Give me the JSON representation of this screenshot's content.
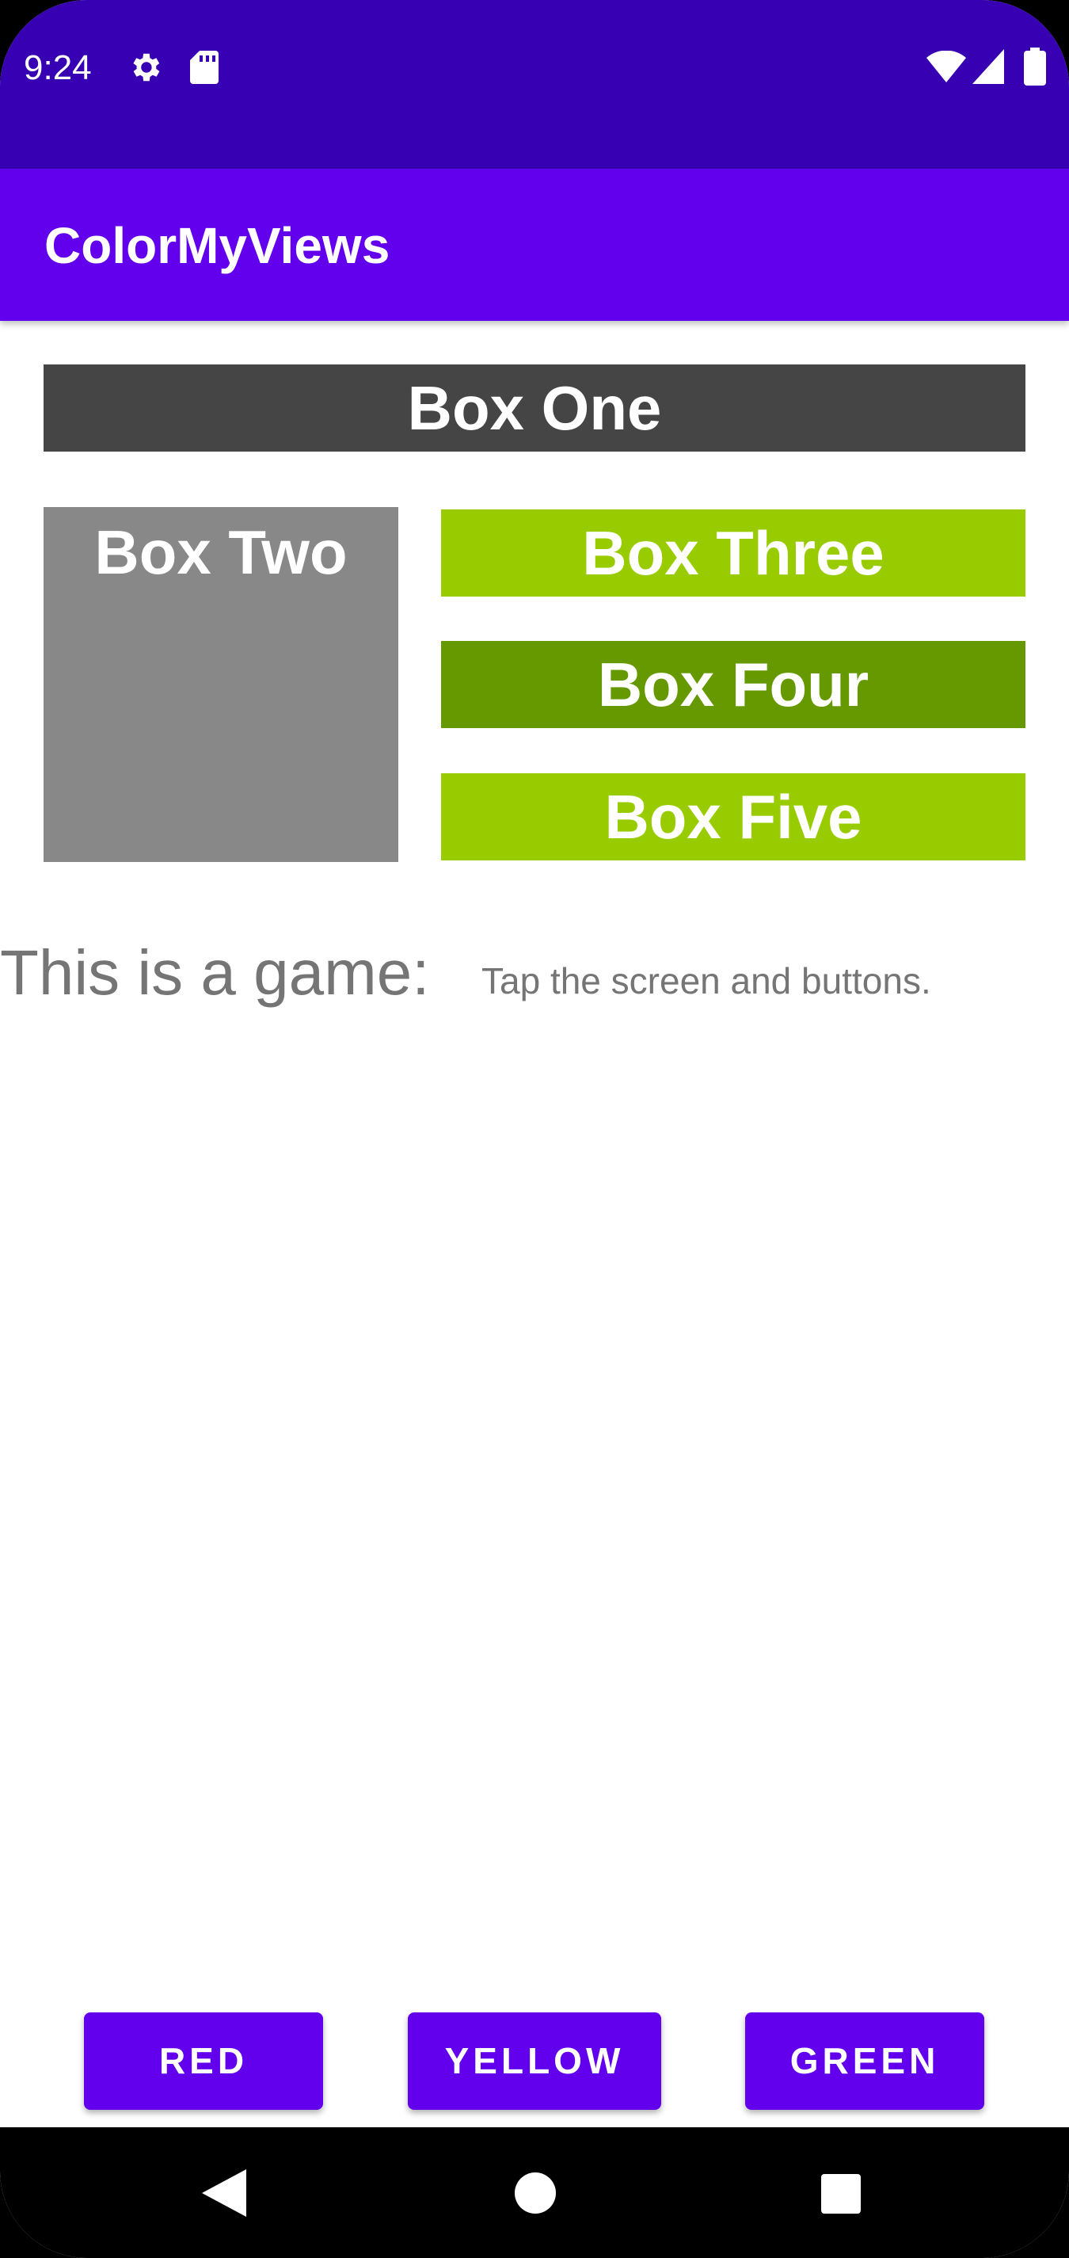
{
  "status_bar": {
    "time": "9:24",
    "icons": [
      "gear-icon",
      "sd-card-icon",
      "wifi-icon",
      "signal-icon",
      "battery-icon"
    ],
    "background": "#3700B3"
  },
  "app_bar": {
    "title": "ColorMyViews",
    "background": "#6200EE"
  },
  "boxes": {
    "one": {
      "label": "Box One",
      "color": "#454545"
    },
    "two": {
      "label": "Box Two",
      "color": "#888888"
    },
    "three": {
      "label": "Box Three",
      "color": "#99CC00"
    },
    "four": {
      "label": "Box Four",
      "color": "#669900"
    },
    "five": {
      "label": "Box Five",
      "color": "#99CC00"
    }
  },
  "labels": {
    "game": "This is a game:",
    "info": "Tap the screen and buttons."
  },
  "buttons": {
    "red": "RED",
    "yellow": "YELLOW",
    "green": "GREEN",
    "color": "#6200EE"
  },
  "nav_bar": {
    "icons": [
      "back-icon",
      "home-icon",
      "recent-apps-icon"
    ]
  }
}
